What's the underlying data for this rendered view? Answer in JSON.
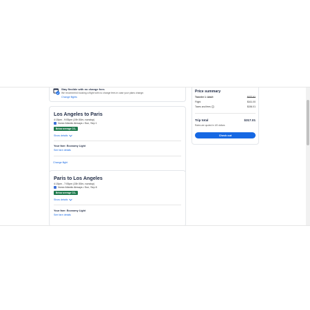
{
  "flex": {
    "title": "Stay flexible with no change fees",
    "description": "We recommend booking a flight with no change fees in case your plans change.",
    "link": "Change flights"
  },
  "outbound": {
    "route": "Los Angeles to Paris",
    "time": "4:15pm - 9:05pm (19h 50m, nonstop)",
    "airline": "Norse Atlantic Airways • Sun, Sep 1",
    "badge": "Below average CO₂",
    "show_details": "Show details",
    "fare": "Your fare: Economy Light",
    "fare_link": "See fare details"
  },
  "change_flight": "Change flight",
  "inbound": {
    "route": "Paris to Los Angeles",
    "time": "4:15pm - 7:05pm (15h 50m, nonstop)",
    "airline": "Norse Atlantic Airways • Sun, Sep 8",
    "badge": "Below average CO₂",
    "show_details": "Show details",
    "fare": "Your fare: Economy Light",
    "fare_link": "See fare details"
  },
  "summary": {
    "title": "Price summary",
    "traveler_label": "Traveler 1: Adult",
    "traveler_value": "$377.01",
    "flight_label": "Flight",
    "flight_value": "$161.00",
    "taxes_label": "Taxes and fees",
    "taxes_value": "$156.01",
    "total_label": "Trip total",
    "total_value": "$317.01",
    "rates_note": "Rates are quoted in US dollars",
    "checkout": "Check out"
  },
  "colors": {
    "accent": "#1668e3",
    "badge": "#1f7a4d",
    "text": "#1f2a44"
  }
}
